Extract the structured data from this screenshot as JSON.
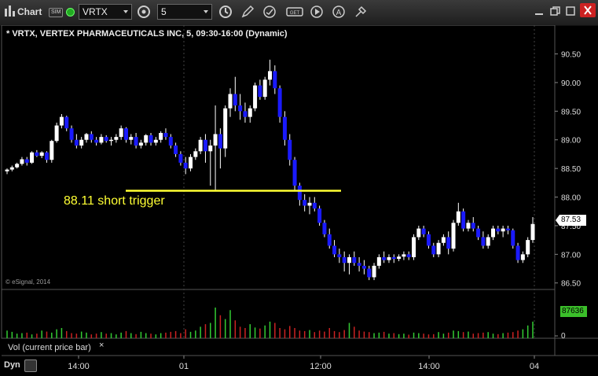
{
  "window": {
    "title": "Chart",
    "sim_badge": "SIM",
    "symbol_value": "VRTX",
    "interval_value": "5"
  },
  "chart_header": {
    "title": "* VRTX, VERTEX PHARMACEUTICALS INC, 5, 09:30-16:00 (Dynamic)"
  },
  "copyright": "© eSignal, 2014",
  "annotation": {
    "label": "88.11 short trigger",
    "price": 88.11,
    "color": "#ffff33"
  },
  "last_price": "87.53",
  "volume_panel": {
    "label": "Vol (current price bar)",
    "close_symbol": "×",
    "last_volume": "87636",
    "axis_zero": "0"
  },
  "footer": {
    "mode_label": "Dyn"
  },
  "colors": {
    "up": "#ffffff",
    "down": "#1a1aff",
    "vol_up": "#33cc33",
    "vol_down": "#cc2222",
    "background": "#000000",
    "grid": "#444444"
  },
  "chart_data": {
    "type": "candlestick",
    "title": "* VRTX, VERTEX PHARMACEUTICALS INC, 5, 09:30-16:00 (Dynamic)",
    "xlabel": "",
    "ylabel": "",
    "ylim": [
      86.4,
      90.7
    ],
    "y_ticks": [
      "90.50",
      "90.00",
      "89.50",
      "89.00",
      "88.50",
      "88.00",
      "87.50",
      "87.00",
      "86.50"
    ],
    "x_ticks": [
      "14:00",
      "01",
      "12:00",
      "14:00",
      "04"
    ],
    "grid": "session dividers only",
    "ohlc": [
      [
        88.45,
        88.5,
        88.4,
        88.48
      ],
      [
        88.48,
        88.55,
        88.45,
        88.52
      ],
      [
        88.52,
        88.6,
        88.5,
        88.58
      ],
      [
        88.58,
        88.7,
        88.55,
        88.66
      ],
      [
        88.66,
        88.7,
        88.55,
        88.6
      ],
      [
        88.6,
        88.8,
        88.58,
        88.78
      ],
      [
        88.78,
        88.82,
        88.7,
        88.72
      ],
      [
        88.72,
        88.8,
        88.68,
        88.78
      ],
      [
        88.78,
        88.8,
        88.6,
        88.65
      ],
      [
        88.65,
        89.0,
        88.6,
        88.98
      ],
      [
        88.98,
        89.3,
        88.95,
        89.25
      ],
      [
        89.25,
        89.45,
        89.2,
        89.4
      ],
      [
        89.4,
        89.42,
        89.15,
        89.2
      ],
      [
        89.2,
        89.25,
        88.95,
        89.0
      ],
      [
        89.0,
        89.1,
        88.85,
        88.9
      ],
      [
        88.9,
        89.05,
        88.85,
        89.0
      ],
      [
        89.0,
        89.12,
        88.95,
        89.1
      ],
      [
        89.1,
        89.15,
        88.95,
        89.0
      ],
      [
        89.0,
        89.05,
        88.9,
        88.95
      ],
      [
        88.95,
        89.1,
        88.92,
        89.05
      ],
      [
        89.05,
        89.08,
        88.95,
        88.98
      ],
      [
        88.98,
        89.05,
        88.9,
        89.0
      ],
      [
        89.0,
        89.1,
        88.95,
        89.05
      ],
      [
        89.05,
        89.25,
        89.0,
        89.2
      ],
      [
        89.2,
        89.22,
        88.95,
        89.0
      ],
      [
        89.0,
        89.1,
        88.92,
        89.05
      ],
      [
        89.05,
        89.12,
        88.85,
        88.9
      ],
      [
        88.9,
        89.0,
        88.85,
        88.95
      ],
      [
        88.95,
        89.1,
        88.9,
        89.08
      ],
      [
        89.08,
        89.12,
        88.9,
        88.95
      ],
      [
        88.95,
        89.05,
        88.9,
        89.0
      ],
      [
        89.0,
        89.15,
        88.95,
        89.12
      ],
      [
        89.12,
        89.2,
        89.0,
        89.05
      ],
      [
        89.05,
        89.1,
        88.85,
        88.9
      ],
      [
        88.9,
        88.95,
        88.7,
        88.75
      ],
      [
        88.75,
        88.8,
        88.55,
        88.6
      ],
      [
        88.6,
        88.7,
        88.4,
        88.5
      ],
      [
        88.5,
        88.75,
        88.45,
        88.7
      ],
      [
        88.7,
        88.85,
        88.65,
        88.8
      ],
      [
        88.8,
        89.05,
        88.75,
        89.0
      ],
      [
        89.0,
        89.1,
        88.6,
        88.8
      ],
      [
        88.8,
        89.0,
        88.2,
        88.9
      ],
      [
        88.9,
        89.6,
        88.1,
        89.1
      ],
      [
        89.1,
        89.2,
        88.5,
        88.85
      ],
      [
        88.85,
        89.6,
        88.7,
        89.55
      ],
      [
        89.55,
        89.9,
        89.4,
        89.8
      ],
      [
        89.8,
        90.1,
        89.5,
        89.6
      ],
      [
        89.6,
        89.8,
        89.35,
        89.5
      ],
      [
        89.5,
        89.65,
        89.3,
        89.4
      ],
      [
        89.4,
        89.6,
        89.3,
        89.55
      ],
      [
        89.55,
        90.0,
        89.5,
        89.95
      ],
      [
        89.95,
        90.05,
        89.7,
        89.75
      ],
      [
        89.75,
        90.1,
        89.7,
        90.05
      ],
      [
        90.05,
        90.4,
        89.95,
        90.2
      ],
      [
        90.2,
        90.3,
        89.8,
        89.9
      ],
      [
        89.9,
        89.95,
        89.3,
        89.4
      ],
      [
        89.4,
        89.5,
        88.9,
        89.0
      ],
      [
        89.0,
        89.1,
        88.55,
        88.65
      ],
      [
        88.65,
        88.7,
        88.1,
        88.2
      ],
      [
        88.2,
        88.25,
        87.85,
        87.95
      ],
      [
        87.95,
        88.05,
        87.75,
        87.85
      ],
      [
        87.85,
        88.0,
        87.7,
        87.9
      ],
      [
        87.9,
        88.0,
        87.75,
        87.8
      ],
      [
        87.8,
        87.85,
        87.5,
        87.55
      ],
      [
        87.55,
        87.6,
        87.3,
        87.35
      ],
      [
        87.35,
        87.45,
        87.1,
        87.15
      ],
      [
        87.15,
        87.25,
        86.95,
        87.0
      ],
      [
        87.0,
        87.1,
        86.85,
        86.95
      ],
      [
        86.95,
        87.05,
        86.7,
        86.85
      ],
      [
        86.85,
        87.0,
        86.65,
        86.95
      ],
      [
        86.95,
        87.05,
        86.8,
        86.85
      ],
      [
        86.85,
        86.95,
        86.7,
        86.8
      ],
      [
        86.8,
        86.9,
        86.65,
        86.75
      ],
      [
        86.75,
        86.8,
        86.55,
        86.6
      ],
      [
        86.6,
        86.85,
        86.55,
        86.8
      ],
      [
        86.8,
        87.0,
        86.75,
        86.95
      ],
      [
        86.95,
        87.05,
        86.85,
        86.9
      ],
      [
        86.9,
        87.0,
        86.85,
        86.95
      ],
      [
        86.95,
        87.0,
        86.85,
        86.92
      ],
      [
        86.92,
        87.0,
        86.88,
        86.96
      ],
      [
        86.96,
        87.05,
        86.9,
        87.0
      ],
      [
        87.0,
        87.05,
        86.9,
        86.95
      ],
      [
        86.95,
        87.35,
        86.9,
        87.3
      ],
      [
        87.3,
        87.5,
        87.25,
        87.45
      ],
      [
        87.45,
        87.5,
        87.3,
        87.35
      ],
      [
        87.35,
        87.4,
        87.1,
        87.15
      ],
      [
        87.15,
        87.2,
        86.95,
        87.0
      ],
      [
        87.0,
        87.25,
        86.95,
        87.2
      ],
      [
        87.2,
        87.35,
        87.15,
        87.3
      ],
      [
        87.3,
        87.4,
        87.0,
        87.1
      ],
      [
        87.1,
        87.6,
        87.05,
        87.55
      ],
      [
        87.55,
        87.9,
        87.5,
        87.75
      ],
      [
        87.75,
        87.8,
        87.4,
        87.45
      ],
      [
        87.45,
        87.6,
        87.4,
        87.55
      ],
      [
        87.55,
        87.65,
        87.4,
        87.45
      ],
      [
        87.45,
        87.5,
        87.25,
        87.3
      ],
      [
        87.3,
        87.4,
        87.1,
        87.15
      ],
      [
        87.15,
        87.35,
        87.1,
        87.3
      ],
      [
        87.3,
        87.5,
        87.25,
        87.45
      ],
      [
        87.45,
        87.5,
        87.35,
        87.4
      ],
      [
        87.4,
        87.5,
        87.3,
        87.45
      ],
      [
        87.45,
        87.5,
        87.35,
        87.42
      ],
      [
        87.42,
        87.45,
        87.1,
        87.15
      ],
      [
        87.15,
        87.2,
        86.85,
        86.9
      ],
      [
        86.9,
        87.05,
        86.85,
        87.0
      ],
      [
        87.0,
        87.3,
        86.95,
        87.25
      ],
      [
        87.25,
        87.65,
        87.2,
        87.53
      ]
    ],
    "volume_max": 160000,
    "volume": [
      30000,
      25000,
      18000,
      20000,
      22000,
      15000,
      18000,
      30000,
      26000,
      22000,
      35000,
      40000,
      28000,
      20000,
      18000,
      26000,
      22000,
      15000,
      18000,
      24000,
      18000,
      20000,
      15000,
      22000,
      28000,
      20000,
      16000,
      25000,
      20000,
      18000,
      15000,
      20000,
      22000,
      25000,
      28000,
      20000,
      35000,
      25000,
      30000,
      45000,
      55000,
      60000,
      120000,
      90000,
      75000,
      110000,
      70000,
      45000,
      40000,
      55000,
      42000,
      38000,
      50000,
      65000,
      60000,
      40000,
      35000,
      48000,
      40000,
      30000,
      28000,
      32000,
      24000,
      30000,
      26000,
      40000,
      28000,
      24000,
      32000,
      60000,
      45000,
      30000,
      26000,
      24000,
      20000,
      22000,
      25000,
      18000,
      20000,
      16000,
      18000,
      14000,
      22000,
      20000,
      18000,
      15000,
      16000,
      24000,
      18000,
      22000,
      30000,
      28000,
      24000,
      26000,
      18000,
      20000,
      22000,
      24000,
      18000,
      16000,
      20000,
      22000,
      24000,
      30000,
      35000,
      50000,
      65000
    ]
  }
}
